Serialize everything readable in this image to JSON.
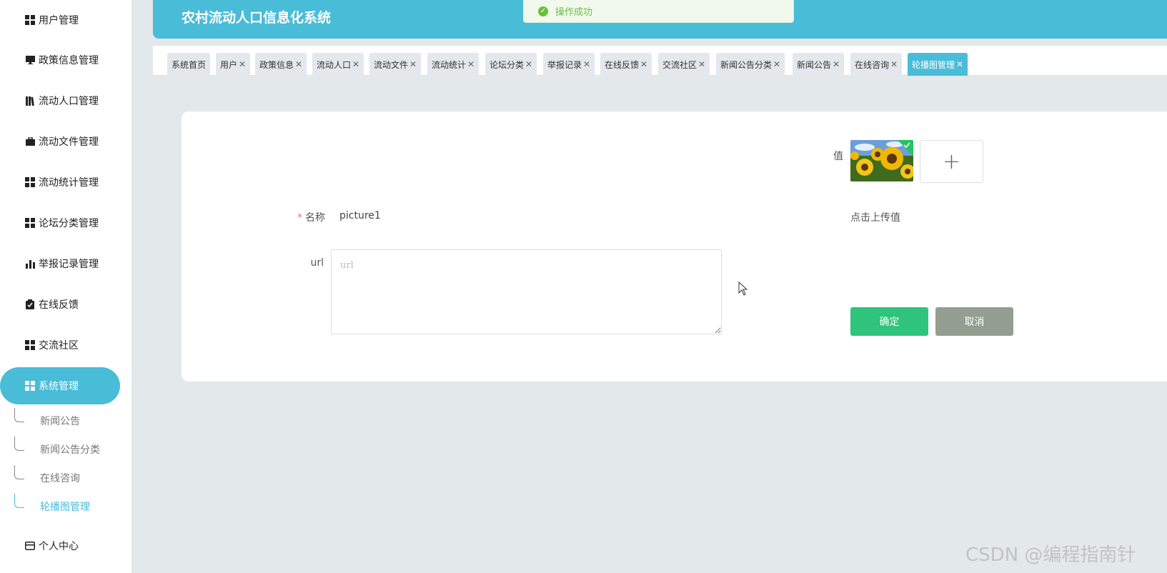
{
  "app": {
    "title": "农村流动人口信息化系统"
  },
  "toast": {
    "message": "操作成功"
  },
  "sidebar": {
    "items": [
      {
        "label": "用户管理",
        "icon": "grid-icon"
      },
      {
        "label": "政策信息管理",
        "icon": "monitor-icon"
      },
      {
        "label": "流动人口管理",
        "icon": "book-icon"
      },
      {
        "label": "流动文件管理",
        "icon": "briefcase-icon"
      },
      {
        "label": "流动统计管理",
        "icon": "grid-icon"
      },
      {
        "label": "论坛分类管理",
        "icon": "grid-icon"
      },
      {
        "label": "举报记录管理",
        "icon": "bar-chart-icon"
      },
      {
        "label": "在线反馈",
        "icon": "clipboard-icon"
      },
      {
        "label": "交流社区",
        "icon": "grid-icon"
      },
      {
        "label": "系统管理",
        "icon": "grid-icon",
        "active": true
      },
      {
        "label": "个人中心",
        "icon": "card-icon"
      }
    ],
    "submenu": [
      {
        "label": "新闻公告"
      },
      {
        "label": "新闻公告分类"
      },
      {
        "label": "在线咨询"
      },
      {
        "label": "轮播图管理",
        "active": true
      }
    ]
  },
  "tabs": [
    {
      "label": "系统首页",
      "closable": false
    },
    {
      "label": "用户",
      "closable": true
    },
    {
      "label": "政策信息",
      "closable": true
    },
    {
      "label": "流动人口",
      "closable": true
    },
    {
      "label": "流动文件",
      "closable": true
    },
    {
      "label": "流动统计",
      "closable": true
    },
    {
      "label": "论坛分类",
      "closable": true
    },
    {
      "label": "举报记录",
      "closable": true
    },
    {
      "label": "在线反馈",
      "closable": true
    },
    {
      "label": "交流社区",
      "closable": true
    },
    {
      "label": "新闻公告分类",
      "closable": true
    },
    {
      "label": "新闻公告",
      "closable": true
    },
    {
      "label": "在线咨询",
      "closable": true
    },
    {
      "label": "轮播图管理",
      "closable": true,
      "active": true
    }
  ],
  "form": {
    "name_label": "名称",
    "name_required_mark": "*",
    "name_value": "picture1",
    "url_label": "url",
    "url_placeholder": "url",
    "value_label": "值",
    "upload_hint": "点击上传值",
    "upload_plus": "+",
    "confirm_label": "确定",
    "cancel_label": "取消"
  },
  "colors": {
    "accent": "#49bcd8",
    "confirm": "#2fc37c",
    "cancel": "#939e91",
    "background": "#e3e8eb"
  },
  "watermark": "CSDN @编程指南针"
}
